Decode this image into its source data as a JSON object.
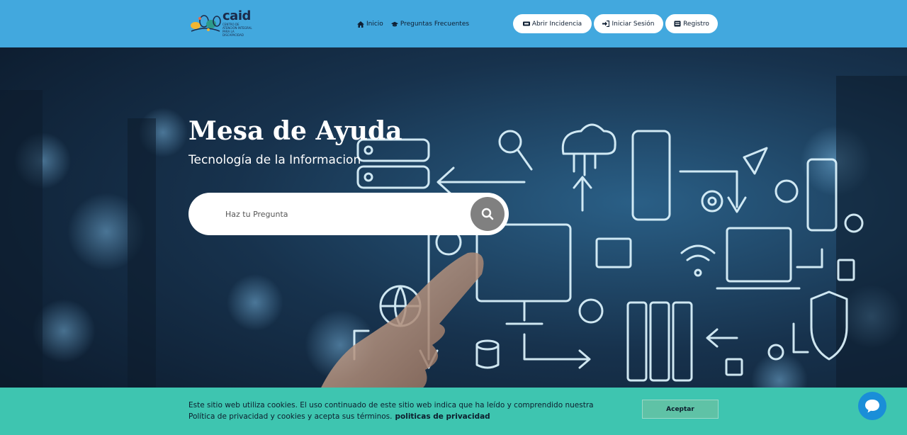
{
  "brand": {
    "name": "caid",
    "tagline": "CENTRO DE ATENCIÓN INTEGRAL PARA LA DISCAPACIDAD"
  },
  "nav": {
    "items": [
      {
        "label": "Inicio",
        "icon": "home-icon"
      },
      {
        "label": "Preguntas Frecuentes",
        "icon": "graduation-cap-icon"
      }
    ]
  },
  "header_buttons": {
    "incidencia": {
      "label": "Abrir Incidencia",
      "icon": "ticket-icon"
    },
    "login": {
      "label": "Iniciar Sesión",
      "icon": "sign-in-icon"
    },
    "registro": {
      "label": "Registro",
      "icon": "id-card-icon"
    }
  },
  "hero": {
    "title": "Mesa de Ayuda",
    "subtitle": "Tecnología de la Informacion",
    "search": {
      "placeholder": "Haz tu Pregunta",
      "icon": "search-icon"
    }
  },
  "cookie": {
    "text": "Este sitio web utiliza cookies. El uso continuado de este sitio web indica que ha leído y comprendido nuestra Política de privacidad y cookies y acepta sus términos.",
    "link_label": "politicas de privacidad",
    "accept_label": "Aceptar"
  },
  "chat": {
    "icon": "chat-bubble-icon"
  },
  "colors": {
    "header_bg": "#42a8de",
    "cookie_bg": "#3ec5b0",
    "chat_bg": "#1a8ed8",
    "search_button": "#808080"
  }
}
